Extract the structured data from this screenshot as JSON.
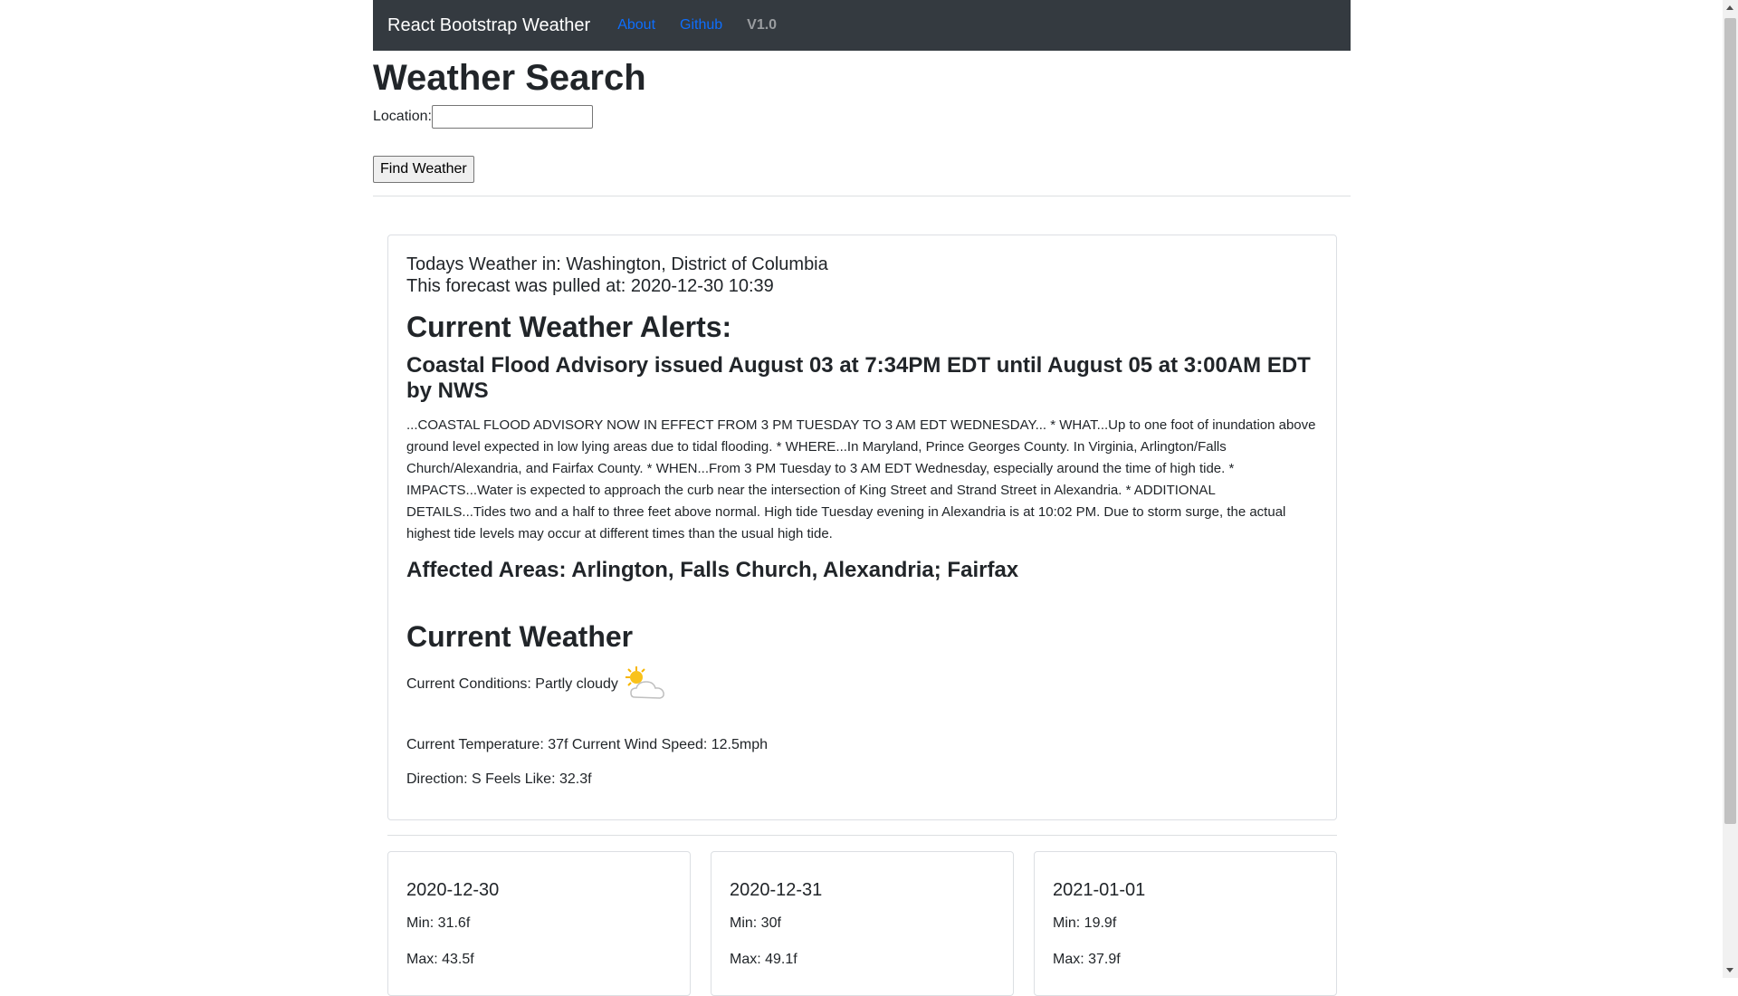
{
  "navbar": {
    "brand": "React Bootstrap Weather",
    "links": [
      "About",
      "Github"
    ],
    "version": "V1.0"
  },
  "search": {
    "title": "Weather Search",
    "location_label": "Location:",
    "location_value": "",
    "button_label": "Find Weather"
  },
  "today": {
    "location_line": "Todays Weather in: Washington, District of Columbia",
    "pulled_line": "This forecast was pulled at: 2020-12-30 10:39"
  },
  "alerts": {
    "heading": "Current Weather Alerts:",
    "headline": "Coastal Flood Advisory issued August 03 at 7:34PM EDT until August 05 at 3:00AM EDT by NWS",
    "description": "...COASTAL FLOOD ADVISORY NOW IN EFFECT FROM 3 PM TUESDAY TO 3 AM EDT WEDNESDAY... * WHAT...Up to one foot of inundation above ground level expected in low lying areas due to tidal flooding. * WHERE...In Maryland, Prince Georges County. In Virginia, Arlington/Falls Church/Alexandria, and Fairfax County. * WHEN...From 3 PM Tuesday to 3 AM EDT Wednesday, especially around the time of high tide. * IMPACTS...Water is expected to approach the curb near the intersection of King Street and Strand Street in Alexandria. * ADDITIONAL DETAILS...Tides two and a half to three feet above normal. High tide Tuesday evening in Alexandria is at 10:02 PM. Due to storm surge, the actual highest tide levels may occur at different times than the usual high tide.",
    "affected": "Affected Areas: Arlington, Falls Church, Alexandria; Fairfax"
  },
  "current": {
    "heading": "Current Weather",
    "conditions": "Current Conditions: Partly cloudy",
    "condition_icon": "partly-cloudy-icon",
    "temp_wind": "Current Temperature: 37f Current Wind Speed: 12.5mph",
    "direction_feels": "Direction: S Feels Like: 32.3f"
  },
  "forecast": [
    {
      "date": "2020-12-30",
      "min": "Min: 31.6f",
      "max": "Max: 43.5f"
    },
    {
      "date": "2020-12-31",
      "min": "Min: 30f",
      "max": "Max: 49.1f"
    },
    {
      "date": "2021-01-01",
      "min": "Min: 19.9f",
      "max": "Max: 37.9f"
    }
  ],
  "colors": {
    "navbar_bg": "#343a40",
    "link": "#0d6efd",
    "text": "#212529"
  }
}
